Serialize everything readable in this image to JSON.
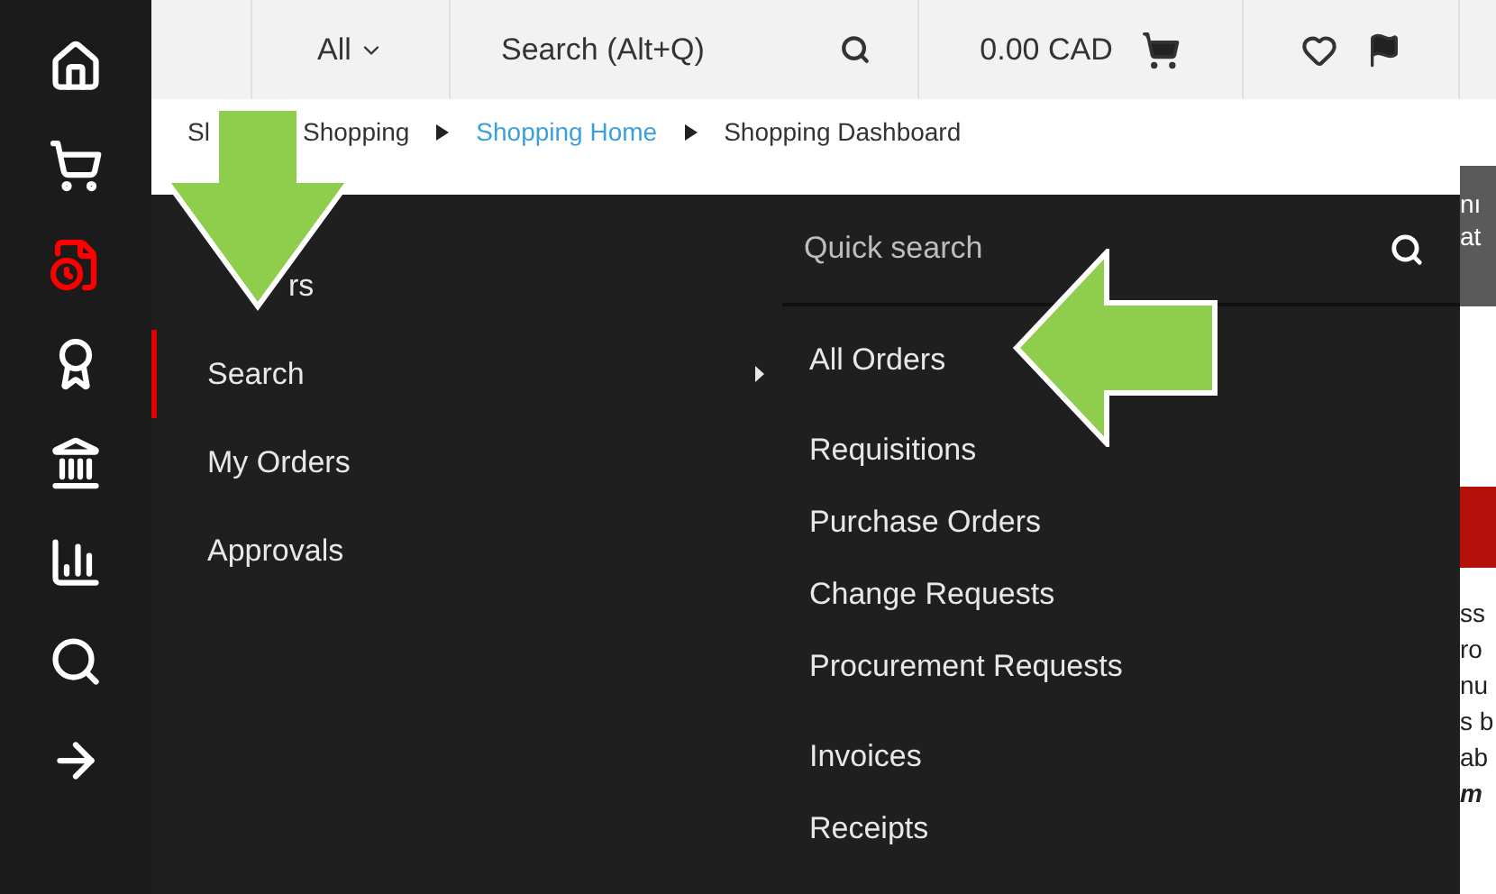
{
  "sidebar": {
    "items": [
      {
        "kind": "home",
        "selected": false
      },
      {
        "kind": "cart",
        "selected": false
      },
      {
        "kind": "orders",
        "selected": true
      },
      {
        "kind": "award",
        "selected": false
      },
      {
        "kind": "bank",
        "selected": false
      },
      {
        "kind": "chart",
        "selected": false
      },
      {
        "kind": "search",
        "selected": false
      },
      {
        "kind": "arrow",
        "selected": false
      }
    ]
  },
  "topbar": {
    "scope": "All",
    "search": {
      "placeholder": "Search (Alt+Q)"
    },
    "cart_total": "0.00 CAD"
  },
  "breadcrumb": [
    {
      "label": "Sl",
      "link": false,
      "covered": true
    },
    {
      "label": "Shopping",
      "link": false
    },
    {
      "label": "Shopping Home",
      "link": true
    },
    {
      "label": "Shopping Dashboard",
      "link": false
    }
  ],
  "background_text": {
    "header": [
      "nı",
      "at"
    ],
    "body": [
      "ss",
      "ro",
      "nu",
      "s b",
      "ab",
      "m"
    ]
  },
  "menu": {
    "categories": [
      {
        "label": "rs",
        "selected": false,
        "covered": true
      },
      {
        "label": "Search",
        "selected": true
      },
      {
        "label": "My Orders",
        "selected": false
      },
      {
        "label": "Approvals",
        "selected": false
      }
    ],
    "quick_search": {
      "placeholder": "Quick search"
    },
    "items": [
      {
        "label": "All Orders",
        "gap_before": false
      },
      {
        "label": "Requisitions",
        "gap_before": true
      },
      {
        "label": "Purchase Orders",
        "gap_before": false
      },
      {
        "label": "Change Requests",
        "gap_before": false
      },
      {
        "label": "Procurement Requests",
        "gap_before": false
      },
      {
        "label": "Invoices",
        "gap_before": true
      },
      {
        "label": "Receipts",
        "gap_before": false
      }
    ]
  }
}
